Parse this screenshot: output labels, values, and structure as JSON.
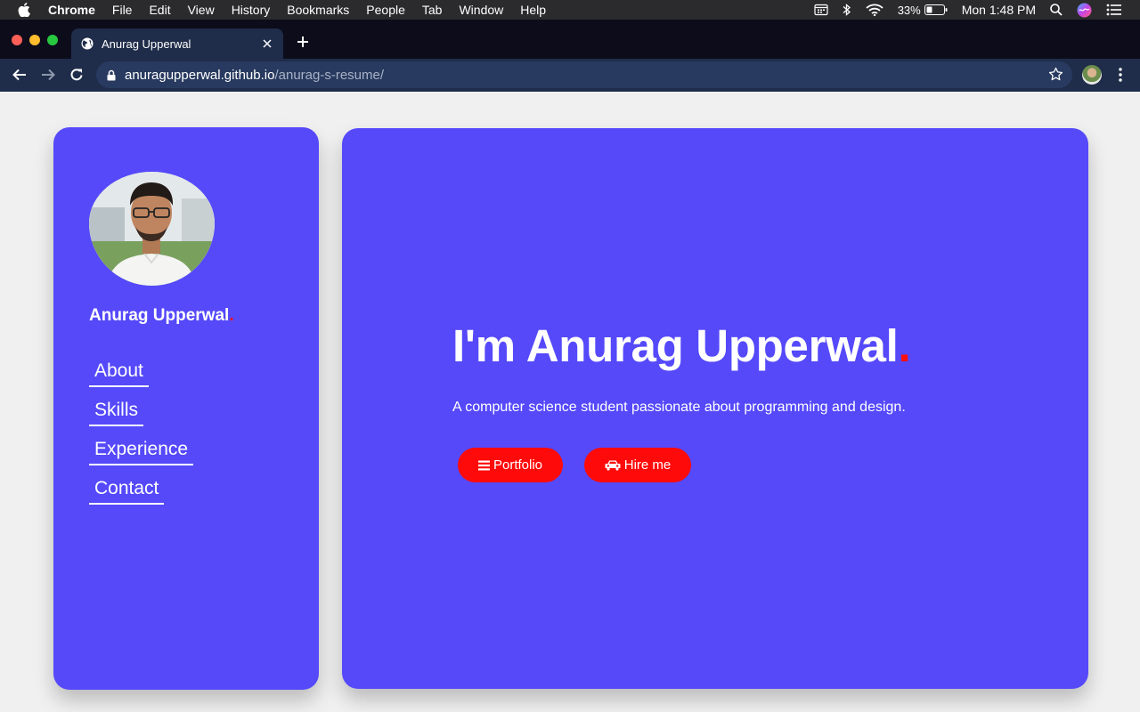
{
  "menubar": {
    "app": "Chrome",
    "items": [
      "File",
      "Edit",
      "View",
      "History",
      "Bookmarks",
      "People",
      "Tab",
      "Window",
      "Help"
    ],
    "battery": "33%",
    "clock": "Mon 1:48 PM"
  },
  "browser": {
    "tab_title": "Anurag Upperwal",
    "url_host": "anuragupperwal.github.io",
    "url_path": "/anurag-s-resume/"
  },
  "sidebar": {
    "name": "Anurag Upperwal",
    "name_dot": ".",
    "nav": [
      "About",
      "Skills",
      "Experience",
      "Contact"
    ]
  },
  "hero": {
    "title": "I'm Anurag Upperwal",
    "title_dot": ".",
    "subtitle": "A computer science student passionate about programming and design.",
    "portfolio_label": "Portfolio",
    "hire_label": "Hire me"
  },
  "colors": {
    "card": "#5549fa",
    "accent": "#ff0a0a",
    "page_bg": "#f0f0f0"
  }
}
